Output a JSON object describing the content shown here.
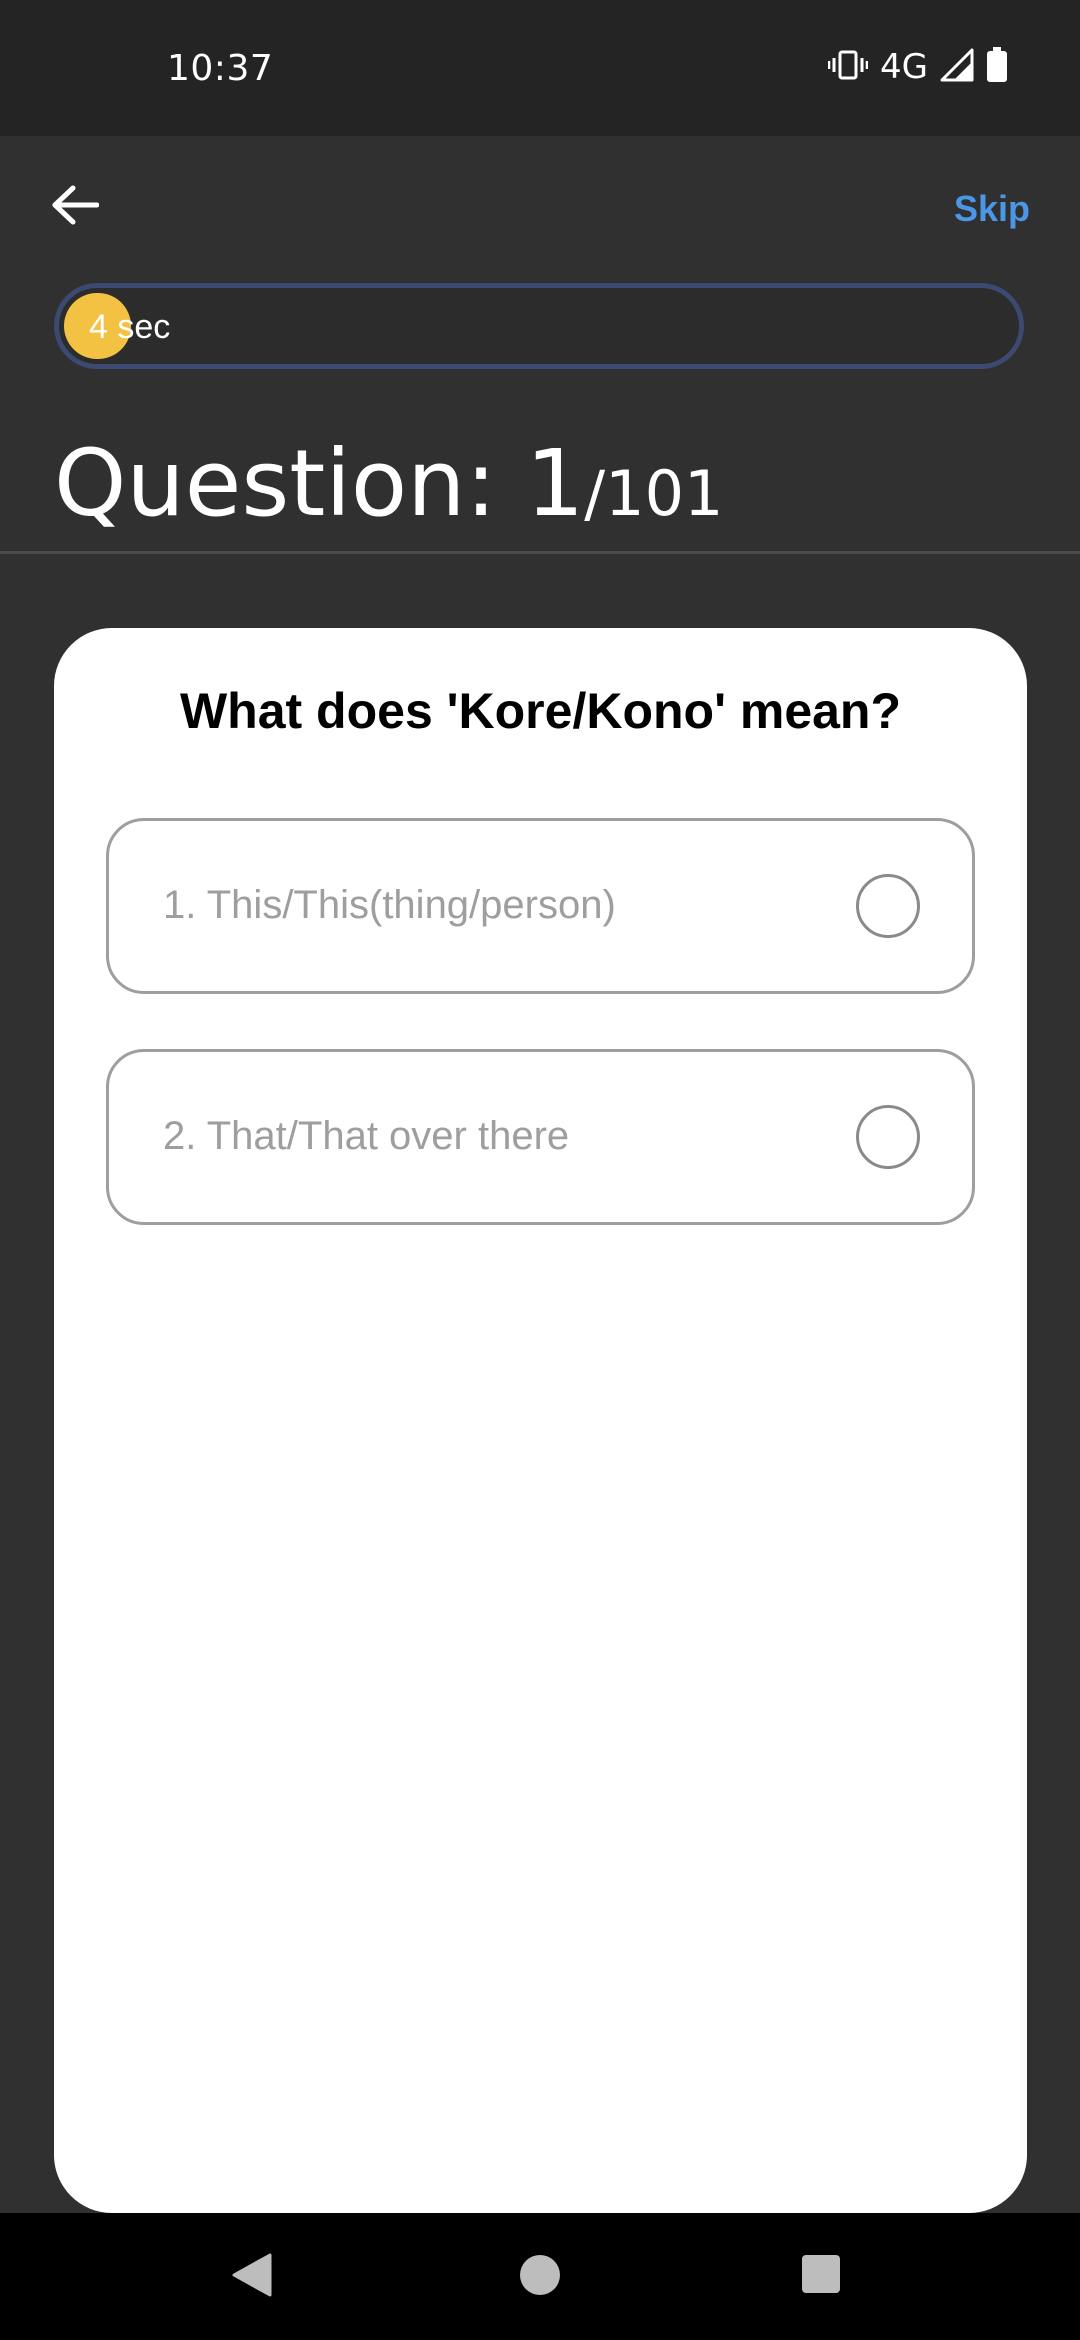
{
  "status_bar": {
    "time": "10:37",
    "network": "4G",
    "icons": [
      "vibrate-icon",
      "signal-icon",
      "battery-icon"
    ]
  },
  "header": {
    "back_icon": "arrow-left-icon",
    "skip_label": "Skip",
    "skip_color": "#4a97e6"
  },
  "timer": {
    "label": "4 sec",
    "progress_fraction": 0.07,
    "fill_color": "#f4c243",
    "track_border_color": "#3c4a72"
  },
  "progress": {
    "label": "Question: 1",
    "total": "/101"
  },
  "quiz": {
    "question": "What does 'Kore/Kono' mean?",
    "options": [
      {
        "label": "1. This/This(thing/person)",
        "selected": false
      },
      {
        "label": "2. That/That over there",
        "selected": false
      }
    ]
  },
  "nav_bar": {
    "icons": [
      "nav-back-icon",
      "nav-home-icon",
      "nav-recents-icon"
    ]
  }
}
